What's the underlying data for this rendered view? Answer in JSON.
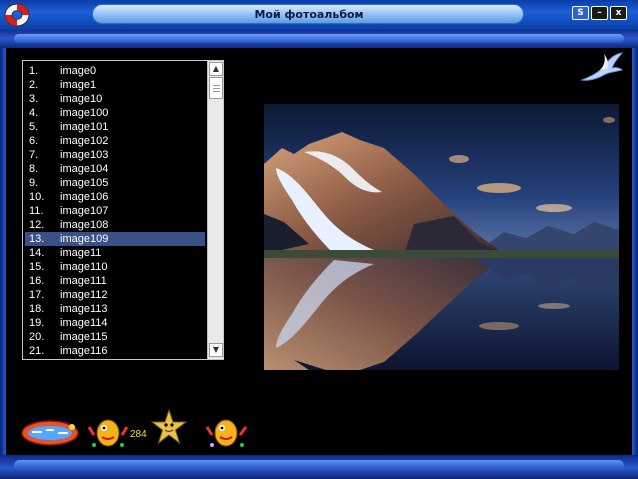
{
  "window": {
    "title": "Мой фотоальбом",
    "buttons": {
      "s_label": "S",
      "minimize_label": "–",
      "close_label": "x"
    }
  },
  "list": {
    "items": [
      {
        "num": "1.",
        "name": "image0"
      },
      {
        "num": "2.",
        "name": "image1"
      },
      {
        "num": "3.",
        "name": "image10"
      },
      {
        "num": "4.",
        "name": "image100"
      },
      {
        "num": "5.",
        "name": "image101"
      },
      {
        "num": "6.",
        "name": "image102"
      },
      {
        "num": "7.",
        "name": "image103"
      },
      {
        "num": "8.",
        "name": "image104"
      },
      {
        "num": "9.",
        "name": "image105"
      },
      {
        "num": "10.",
        "name": "image106"
      },
      {
        "num": "11.",
        "name": "image107"
      },
      {
        "num": "12.",
        "name": "image108"
      },
      {
        "num": "13.",
        "name": "image109"
      },
      {
        "num": "14.",
        "name": "image11"
      },
      {
        "num": "15.",
        "name": "image110"
      },
      {
        "num": "16.",
        "name": "image111"
      },
      {
        "num": "17.",
        "name": "image112"
      },
      {
        "num": "18.",
        "name": "image113"
      },
      {
        "num": "19.",
        "name": "image114"
      },
      {
        "num": "20.",
        "name": "image115"
      },
      {
        "num": "21.",
        "name": "image116"
      }
    ],
    "selected_index": 12
  },
  "counter": "284",
  "icons": {
    "app": "lifebuoy-icon",
    "corner": "seagull-icon",
    "decor": [
      "fish-banner-icon",
      "fish-dancer-icon",
      "starfish-icon",
      "fish-dancer-icon"
    ]
  },
  "colors": {
    "background": "#000000",
    "frame_blue": "#2a58cf",
    "selection": "#3a5088",
    "title_text": "#0b1a4a"
  }
}
